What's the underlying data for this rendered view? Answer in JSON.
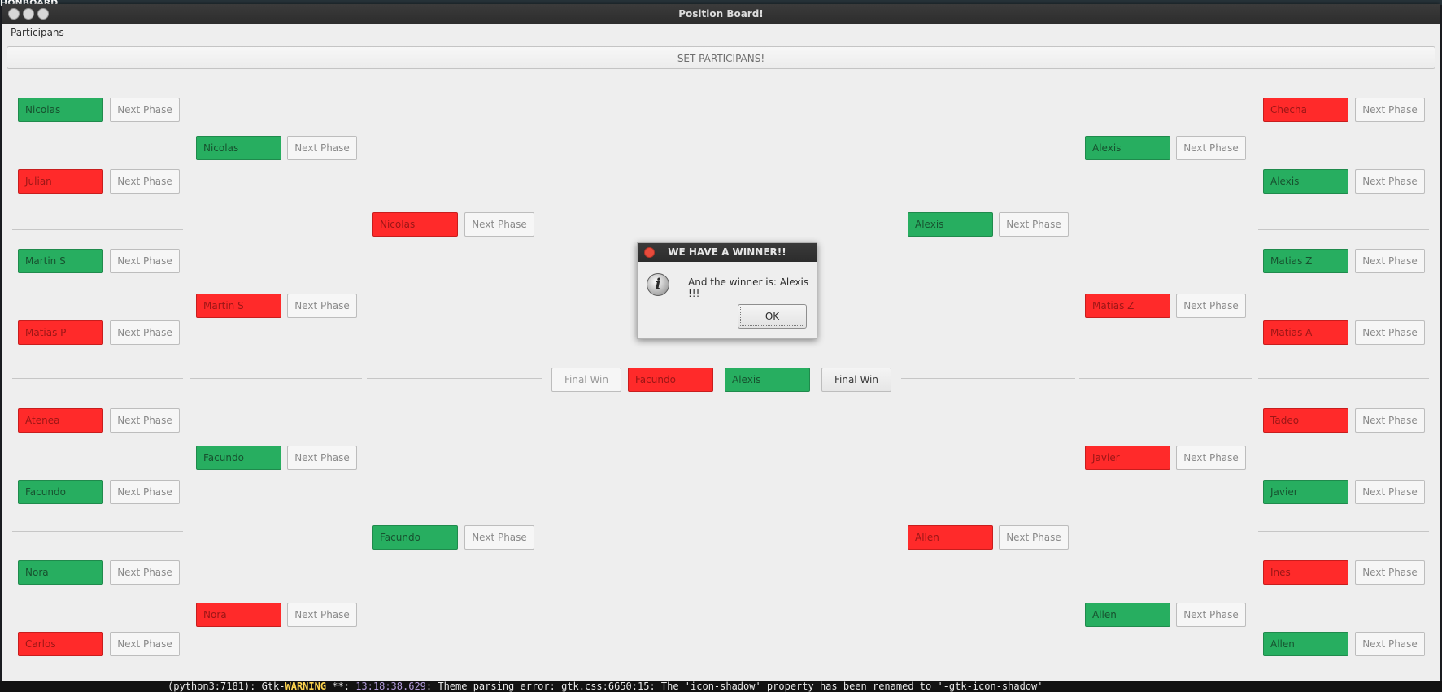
{
  "background": {
    "label": "HONBOARD",
    "terminal_prefix": "(python3:7181): Gtk-",
    "terminal_warning": "WARNING",
    "terminal_mid": " **: ",
    "terminal_time": "13:18:38.629",
    "terminal_message": ": Theme parsing error: gtk.css:6650:15: The 'icon-shadow' property has been renamed to '-gtk-icon-shadow'"
  },
  "window": {
    "title": "Position Board!",
    "menu_participans": "Participans",
    "set_button": "SET PARTICIPANS!"
  },
  "colors": {
    "winner": "#27ae60",
    "loser": "#ff2a2a"
  },
  "next_phase_label": "Next Phase",
  "round1_left": [
    {
      "name": "Nicolas",
      "status": "green"
    },
    {
      "name": "Julian",
      "status": "red"
    },
    {
      "name": "Martin S",
      "status": "green"
    },
    {
      "name": "Matias P",
      "status": "red"
    },
    {
      "name": "Atenea",
      "status": "red"
    },
    {
      "name": "Facundo",
      "status": "green"
    },
    {
      "name": "Nora",
      "status": "green"
    },
    {
      "name": "Carlos",
      "status": "red"
    }
  ],
  "round2_left": [
    {
      "name": "Nicolas",
      "status": "green"
    },
    {
      "name": "Martin S",
      "status": "red"
    },
    {
      "name": "Facundo",
      "status": "green"
    },
    {
      "name": "Nora",
      "status": "red"
    }
  ],
  "round3_left": [
    {
      "name": "Nicolas",
      "status": "red"
    },
    {
      "name": "Facundo",
      "status": "green"
    }
  ],
  "round1_right": [
    {
      "name": "Checha",
      "status": "red"
    },
    {
      "name": "Alexis",
      "status": "green"
    },
    {
      "name": "Matias Z",
      "status": "green"
    },
    {
      "name": "Matias A",
      "status": "red"
    },
    {
      "name": "Tadeo",
      "status": "red"
    },
    {
      "name": "Javier",
      "status": "green"
    },
    {
      "name": "Ines",
      "status": "red"
    },
    {
      "name": "Allen",
      "status": "green"
    }
  ],
  "round2_right": [
    {
      "name": "Alexis",
      "status": "green"
    },
    {
      "name": "Matias Z",
      "status": "red"
    },
    {
      "name": "Javier",
      "status": "red"
    },
    {
      "name": "Allen",
      "status": "green"
    }
  ],
  "round3_right": [
    {
      "name": "Alexis",
      "status": "green"
    },
    {
      "name": "Allen",
      "status": "red"
    }
  ],
  "final": {
    "left_button": "Final Win",
    "left_name": "Facundo",
    "left_status": "red",
    "right_name": "Alexis",
    "right_status": "green",
    "right_button": "Final Win"
  },
  "dialog": {
    "title": "WE HAVE A WINNER!!",
    "message": "And the winner is: Alexis !!!",
    "ok": "OK"
  }
}
